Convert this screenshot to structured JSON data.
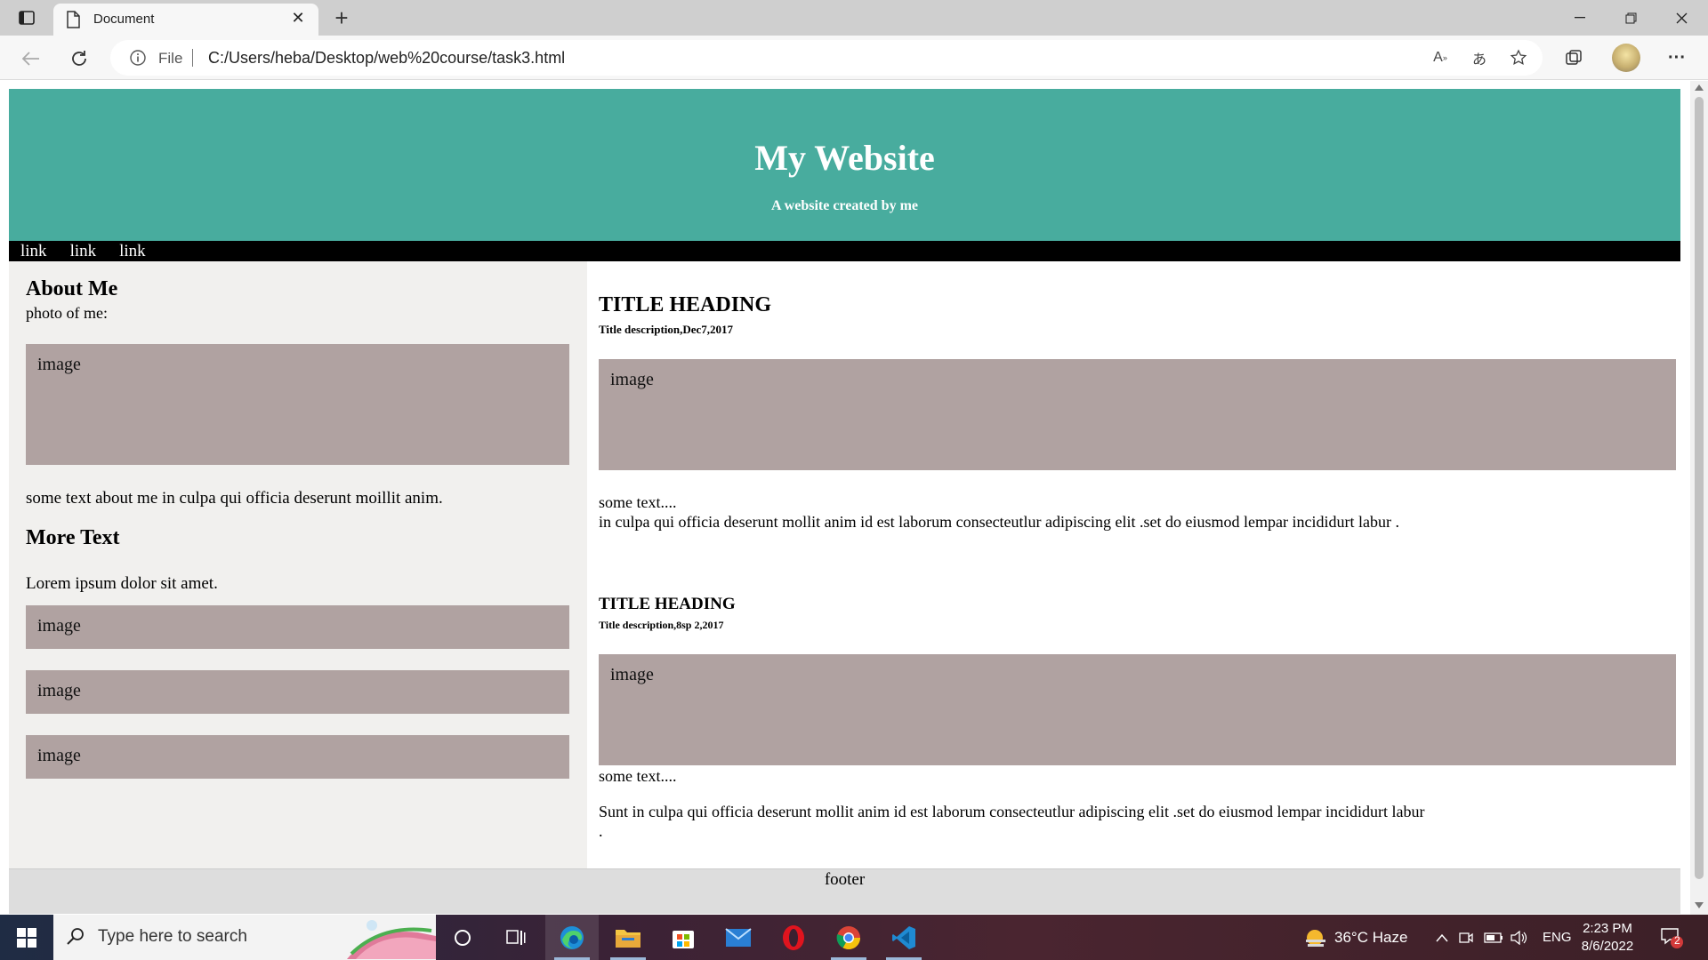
{
  "browser": {
    "tab_title": "Document",
    "address": {
      "scheme_label": "File",
      "url": "C:/Users/heba/Desktop/web%20course/task3.html"
    }
  },
  "site": {
    "header": {
      "title": "My Website",
      "subtitle": "A website created by me"
    },
    "nav_links": [
      "link",
      "link",
      "link"
    ],
    "side": {
      "about_heading": "About Me",
      "photo_label": "photo of me:",
      "image_placeholder": "image",
      "about_text": "some text about me in culpa qui officia deserunt moillit anim.",
      "more_heading": "More Text",
      "lorem_text": "Lorem ipsum dolor sit amet.",
      "small_images": [
        "image",
        "image",
        "image"
      ]
    },
    "main": {
      "posts": [
        {
          "title": "TITLE HEADING",
          "description": "Title description,Dec7,2017",
          "image_label": "image",
          "some_text": "some text....",
          "body": "in culpa qui officia deserunt mollit anim id est laborum consecteutlur adipiscing elit .set do eiusmod lempar incididurt labur ."
        },
        {
          "title": "TITLE HEADING",
          "description": "Title description,8sp 2,2017",
          "image_label": "image",
          "some_text": "some text....",
          "body": "Sunt in culpa qui officia deserunt mollit anim id est laborum consecteutlur adipiscing elit .set do eiusmod lempar incididurt labur",
          "trailing": "."
        }
      ]
    },
    "footer": "footer"
  },
  "taskbar": {
    "search_placeholder": "Type here to search",
    "weather": "36°C  Haze",
    "language": "ENG",
    "time": "2:23 PM",
    "date": "8/6/2022",
    "notification_count": "2",
    "apps": [
      "task-view-icon",
      "edge-icon",
      "file-explorer-icon",
      "store-icon",
      "mail-icon",
      "opera-icon",
      "chrome-icon",
      "vscode-icon"
    ]
  },
  "colors": {
    "header_bg": "#48ac9e",
    "nav_bg": "#000000",
    "side_bg": "#f1f0ee",
    "image_placeholder_bg": "#b0a2a1",
    "footer_bg": "#dddddd"
  }
}
